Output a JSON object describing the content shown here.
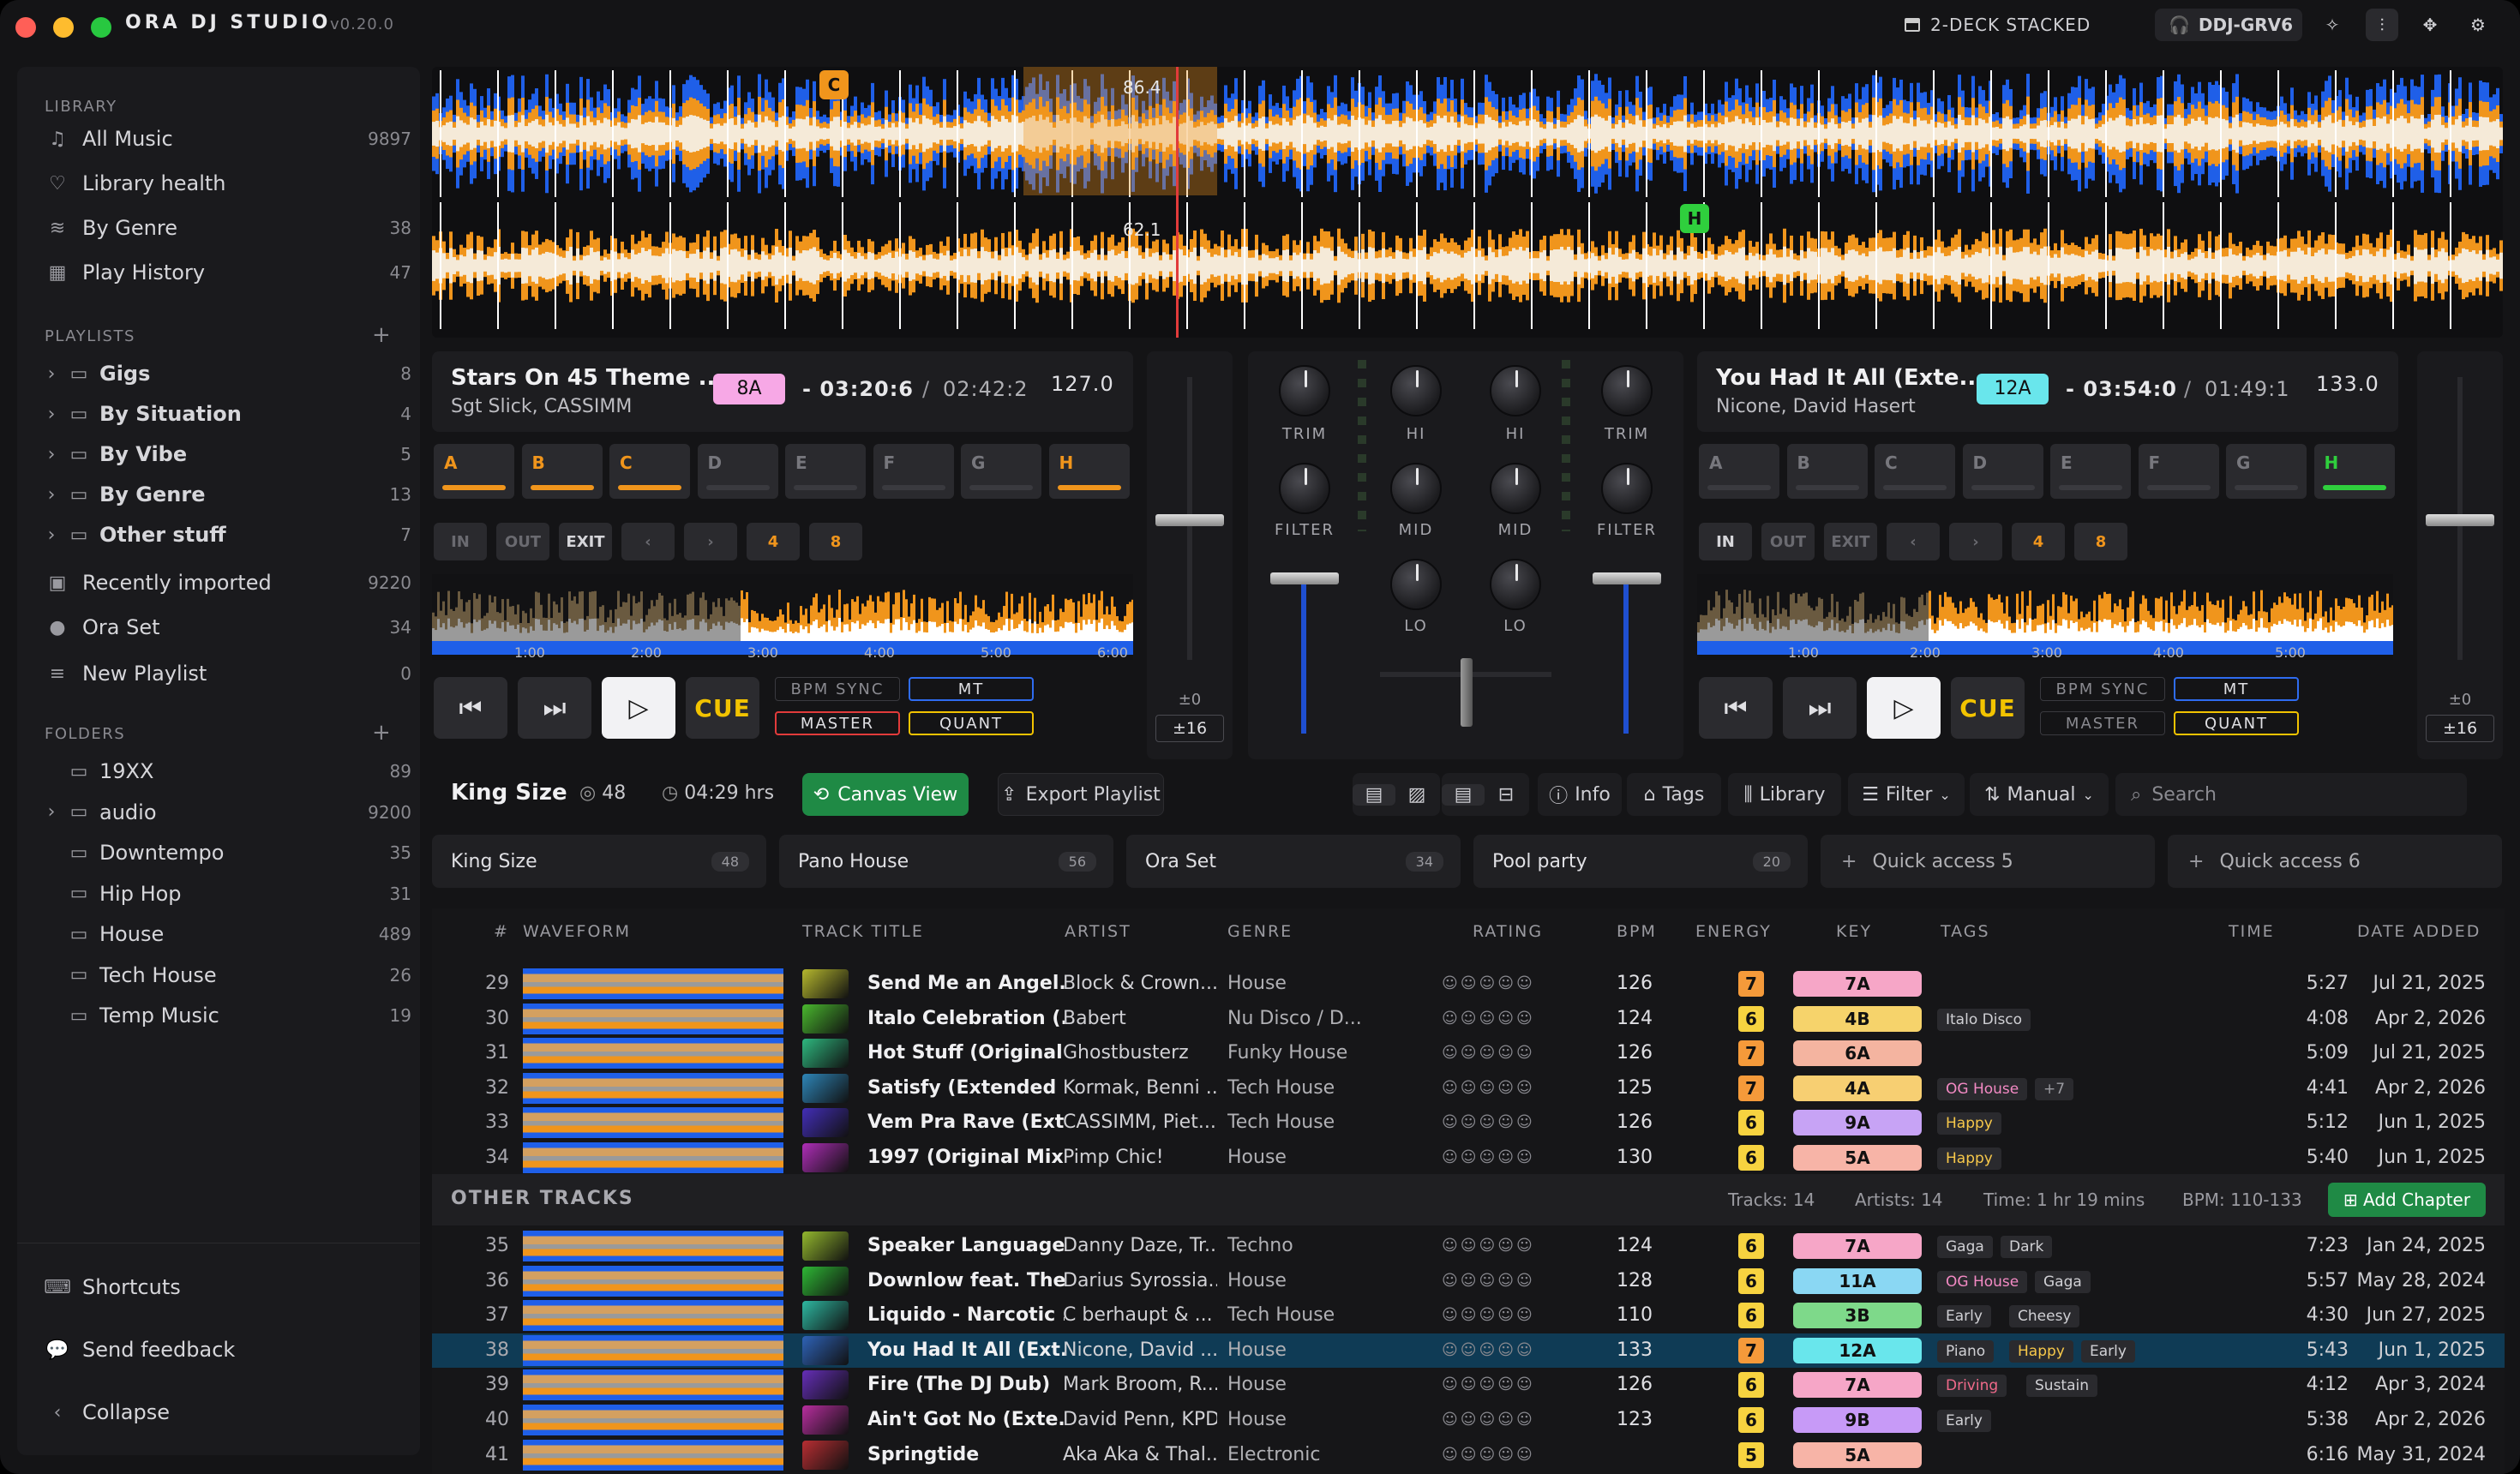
{
  "app": {
    "name": "ORA DJ STUDIO",
    "version": "v0.20.0"
  },
  "titlebar": {
    "layout_label": "2-DECK STACKED",
    "controller": "DDJ-GRV6"
  },
  "colors": {
    "accent_orange": "#f0951c",
    "accent_blue": "#1f5fe8",
    "green": "#22b24c",
    "red": "#e23b3b",
    "yellow": "#f2c300"
  },
  "sidebar": {
    "library_header": "LIBRARY",
    "library": [
      {
        "label": "All Music",
        "count": "9897",
        "icon": "music-note-icon"
      },
      {
        "label": "Library health",
        "count": "",
        "icon": "heart-pulse-icon"
      },
      {
        "label": "By Genre",
        "count": "38",
        "icon": "layers-icon"
      },
      {
        "label": "Play History",
        "count": "47",
        "icon": "calendar-icon"
      }
    ],
    "playlists_header": "PLAYLISTS",
    "playlists": [
      {
        "label": "Gigs",
        "count": "8"
      },
      {
        "label": "By Situation",
        "count": "4"
      },
      {
        "label": "By Vibe",
        "count": "5"
      },
      {
        "label": "By Genre",
        "count": "13"
      },
      {
        "label": "Other stuff",
        "count": "7"
      }
    ],
    "recently_imported": {
      "label": "Recently imported",
      "count": "9220"
    },
    "ora_set": {
      "label": "Ora Set",
      "count": "34"
    },
    "new_playlist": {
      "label": "New Playlist",
      "count": "0"
    },
    "folders_header": "FOLDERS",
    "folders": [
      {
        "label": "19XX",
        "count": "89"
      },
      {
        "label": "audio",
        "count": "9200"
      },
      {
        "label": "Downtempo",
        "count": "35"
      },
      {
        "label": "Hip Hop",
        "count": "31"
      },
      {
        "label": "House",
        "count": "489"
      },
      {
        "label": "Tech House",
        "count": "26"
      },
      {
        "label": "Temp Music",
        "count": "19"
      }
    ],
    "shortcuts": "Shortcuts",
    "feedback": "Send feedback",
    "collapse": "Collapse"
  },
  "waveform": {
    "bpm_top": "86.4",
    "bpm_bottom": "62.1",
    "marker_top": "C",
    "marker_bottom": "H"
  },
  "deck_a": {
    "title": "Stars On 45 Theme ...",
    "artist": "Sgt Slick, CASSIMM",
    "key": "8A",
    "elapsed": "- 03:20:6",
    "total": "02:42:2",
    "bpm": "127.0",
    "hotcues": [
      "A",
      "B",
      "C",
      "D",
      "E",
      "F",
      "G",
      "H"
    ],
    "loop": [
      "IN",
      "OUT",
      "EXIT",
      "‹",
      "›",
      "4",
      "8"
    ],
    "times": [
      "1:00",
      "2:00",
      "3:00",
      "4:00",
      "5:00",
      "6:00"
    ],
    "cue": "CUE",
    "bpm_sync": "BPM SYNC",
    "mt": "MT",
    "master": "MASTER",
    "quant": "QUANT",
    "pitch_range": "±16",
    "pitch_zero": "±0"
  },
  "deck_b": {
    "title": "You Had It All (Exte...",
    "artist": "Nicone, David Hasert",
    "key": "12A",
    "elapsed": "- 03:54:0",
    "total": "01:49:1",
    "bpm": "133.0",
    "hotcues": [
      "A",
      "B",
      "C",
      "D",
      "E",
      "F",
      "G",
      "H"
    ],
    "loop": [
      "IN",
      "OUT",
      "EXIT",
      "‹",
      "›",
      "4",
      "8"
    ],
    "times": [
      "1:00",
      "2:00",
      "3:00",
      "4:00",
      "5:00"
    ],
    "cue": "CUE",
    "bpm_sync": "BPM SYNC",
    "mt": "MT",
    "master": "MASTER",
    "quant": "QUANT",
    "pitch_range": "±16",
    "pitch_zero": "±0"
  },
  "mixer": {
    "trim": "TRIM",
    "hi": "HI",
    "filter": "FILTER",
    "mid": "MID",
    "lo": "LO"
  },
  "playlist_bar": {
    "name": "King Size",
    "count": "48",
    "duration": "04:29 hrs",
    "canvas": "Canvas View",
    "export": "Export Playlist",
    "info": "Info",
    "tags": "Tags",
    "library": "Library",
    "filter": "Filter",
    "sort": "Manual",
    "search_placeholder": "Search"
  },
  "quick_access": [
    {
      "label": "King Size",
      "count": "48"
    },
    {
      "label": "Pano House",
      "count": "56"
    },
    {
      "label": "Ora Set",
      "count": "34"
    },
    {
      "label": "Pool party",
      "count": "20"
    },
    {
      "label": "Quick access 5",
      "count": ""
    },
    {
      "label": "Quick access 6",
      "count": ""
    }
  ],
  "columns": [
    "#",
    "WAVEFORM",
    "TRACK TITLE",
    "ARTIST",
    "GENRE",
    "RATING",
    "BPM",
    "ENERGY",
    "KEY",
    "TAGS",
    "TIME",
    "DATE ADDED"
  ],
  "tracks_top": [
    {
      "n": "29",
      "title": "Send Me an Angel...",
      "artist": "Block & Crown...",
      "genre": "House",
      "bpm": "126",
      "energy": "7",
      "key": "7A",
      "tags": [],
      "time": "5:27",
      "date": "Jul 21, 2025"
    },
    {
      "n": "30",
      "title": "Italo Celebration (...",
      "artist": "Babert",
      "genre": "Nu Disco / D...",
      "bpm": "124",
      "energy": "6",
      "key": "4B",
      "tags": [
        "Italo Disco"
      ],
      "time": "4:08",
      "date": "Apr 2, 2026"
    },
    {
      "n": "31",
      "title": "Hot Stuff (Original ...",
      "artist": "Ghostbusterz",
      "genre": "Funky House",
      "bpm": "126",
      "energy": "7",
      "key": "6A",
      "tags": [],
      "time": "5:09",
      "date": "Jul 21, 2025"
    },
    {
      "n": "32",
      "title": "Satisfy (Extended ...",
      "artist": "Kormak, Benni ...",
      "genre": "Tech House",
      "bpm": "125",
      "energy": "7",
      "key": "4A",
      "tags": [
        "OG House",
        "+7"
      ],
      "time": "4:41",
      "date": "Apr 2, 2026"
    },
    {
      "n": "33",
      "title": "Vem Pra Rave (Ext...",
      "artist": "CASSIMM, Piet...",
      "genre": "Tech House",
      "bpm": "126",
      "energy": "6",
      "key": "9A",
      "tags": [
        "Happy"
      ],
      "time": "5:12",
      "date": "Jun 1, 2025"
    },
    {
      "n": "34",
      "title": "1997 (Original Mix)",
      "artist": "Pimp Chic!",
      "genre": "House",
      "bpm": "130",
      "energy": "6",
      "key": "5A",
      "tags": [
        "Happy"
      ],
      "time": "5:40",
      "date": "Jun 1, 2025"
    }
  ],
  "other_tracks": {
    "header": "OTHER TRACKS",
    "tracks": "Tracks: 14",
    "artists": "Artists: 14",
    "time": "Time: 1 hr 19 mins",
    "bpm": "BPM: 110-133",
    "add_chapter": "Add Chapter"
  },
  "tracks_bottom": [
    {
      "n": "35",
      "title": "Speaker Language...",
      "artist": "Danny Daze, Tr...",
      "genre": "Techno",
      "bpm": "124",
      "energy": "6",
      "key": "7A",
      "tags": [
        "Gaga",
        "Dark"
      ],
      "time": "7:23",
      "date": "Jan 24, 2025"
    },
    {
      "n": "36",
      "title": "Downlow feat. The...",
      "artist": "Darius Syrossia...",
      "genre": "House",
      "bpm": "128",
      "energy": "6",
      "key": "11A",
      "tags": [
        "OG House",
        "Gaga"
      ],
      "time": "5:57",
      "date": "May 28, 2024"
    },
    {
      "n": "37",
      "title": "Liquido - Narcotic ...",
      "artist": "C berhaupt & ...",
      "genre": "Tech House",
      "bpm": "110",
      "energy": "6",
      "key": "3B",
      "tags": [
        "Early",
        "Cheesy"
      ],
      "time": "4:30",
      "date": "Jun 27, 2025"
    },
    {
      "n": "38",
      "title": "You Had It All (Ext...",
      "artist": "Nicone, David ...",
      "genre": "House",
      "bpm": "133",
      "energy": "7",
      "key": "12A",
      "tags": [
        "Piano",
        "Happy",
        "Early"
      ],
      "time": "5:43",
      "date": "Jun 1, 2025"
    },
    {
      "n": "39",
      "title": "Fire (The DJ Dub)",
      "artist": "Mark Broom, R...",
      "genre": "House",
      "bpm": "126",
      "energy": "6",
      "key": "7A",
      "tags": [
        "Driving",
        "Sustain"
      ],
      "time": "4:12",
      "date": "Apr 3, 2024"
    },
    {
      "n": "40",
      "title": "Ain't Got No (Exte...",
      "artist": "David Penn, KPD",
      "genre": "House",
      "bpm": "123",
      "energy": "6",
      "key": "9B",
      "tags": [
        "Early"
      ],
      "time": "5:38",
      "date": "Apr 2, 2026"
    },
    {
      "n": "41",
      "title": "Springtide",
      "artist": "Aka Aka & Thal...",
      "genre": "Electronic",
      "bpm": "",
      "energy": "5",
      "key": "5A",
      "tags": [],
      "time": "6:16",
      "date": "May 31, 2024"
    }
  ]
}
